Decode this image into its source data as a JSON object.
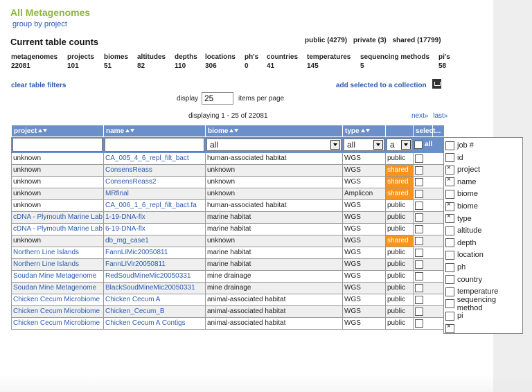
{
  "page": {
    "title": "All Metagenomes",
    "group_by": "group by project"
  },
  "counts": {
    "title": "Current table counts",
    "public": "public (4279)",
    "private": "private (3)",
    "shared": "shared (17799)",
    "cols": [
      {
        "label": "metagenomes",
        "value": "22081"
      },
      {
        "label": "projects",
        "value": "101"
      },
      {
        "label": "biomes",
        "value": "51"
      },
      {
        "label": "altitudes",
        "value": "82"
      },
      {
        "label": "depths",
        "value": "110"
      },
      {
        "label": "locations",
        "value": "306"
      },
      {
        "label": "ph's",
        "value": "0"
      },
      {
        "label": "countries",
        "value": "41"
      },
      {
        "label": "temperatures",
        "value": "145"
      },
      {
        "label": "sequencing methods",
        "value": "5"
      },
      {
        "label": "pi's",
        "value": "58"
      }
    ]
  },
  "toolbar": {
    "clear_filters": "clear table filters",
    "add_selected": "add selected to a collection",
    "display_label": "display",
    "display_value": "25",
    "per_page": "items per page",
    "displaying": "displaying 1 - 25 of 22081",
    "next": "next»",
    "last": "last»"
  },
  "table": {
    "headers": {
      "project": "project",
      "name": "name",
      "biome": "biome",
      "type": "type",
      "select": "select",
      "more": "..."
    },
    "filters": {
      "biome": "all",
      "type": "all",
      "sharing": "a",
      "select_all": "all"
    },
    "rows": [
      {
        "project": "unknown",
        "name": "CA_005_4_6_repl_filt_bact",
        "biome": "human-associated habitat",
        "type": "WGS",
        "sharing": "public"
      },
      {
        "project": "unknown",
        "name": "ConsensReass",
        "biome": "unknown",
        "type": "WGS",
        "sharing": "shared"
      },
      {
        "project": "unknown",
        "name": "ConsensReass2",
        "biome": "unknown",
        "type": "WGS",
        "sharing": "shared"
      },
      {
        "project": "unknown",
        "name": "MRfinal",
        "biome": "unknown",
        "type": "Amplicon",
        "sharing": "shared"
      },
      {
        "project": "unknown",
        "name": "CA_006_1_6_repl_filt_bact.fa",
        "biome": "human-associated habitat",
        "type": "WGS",
        "sharing": "public"
      },
      {
        "project": "cDNA - Plymouth Marine Lab Coastal Waters project",
        "name": "1-19-DNA-flx",
        "biome": "marine habitat",
        "type": "WGS",
        "sharing": "public"
      },
      {
        "project": "cDNA - Plymouth Marine Lab Coastal Waters project",
        "name": "6-19-DNA-flx",
        "biome": "marine habitat",
        "type": "WGS",
        "sharing": "public"
      },
      {
        "project": "unknown",
        "name": "db_mg_case1",
        "biome": "unknown",
        "type": "WGS",
        "sharing": "shared"
      },
      {
        "project": "Northern Line Islands",
        "name": "FannLIMic20050811",
        "biome": "marine habitat",
        "type": "WGS",
        "sharing": "public"
      },
      {
        "project": "Northern Line Islands",
        "name": "FannLIVir20050811",
        "biome": "marine habitat",
        "type": "WGS",
        "sharing": "public"
      },
      {
        "project": "Soudan Mine Metagenome",
        "name": "RedSoudMineMic20050331",
        "biome": "mine drainage",
        "type": "WGS",
        "sharing": "public"
      },
      {
        "project": "Soudan Mine Metagenome",
        "name": "BlackSoudMineMic20050331",
        "biome": "mine drainage",
        "type": "WGS",
        "sharing": "public"
      },
      {
        "project": "Chicken Cecum Microbiome",
        "name": "Chicken Cecum A",
        "biome": "animal-associated habitat",
        "type": "WGS",
        "sharing": "public"
      },
      {
        "project": "Chicken Cecum Microbiome",
        "name": "Chicken_Cecum_B",
        "biome": "animal-associated habitat",
        "type": "WGS",
        "sharing": "public"
      },
      {
        "project": "Chicken Cecum Microbiome",
        "name": "Chicken Cecum A Contigs",
        "biome": "animal-associated habitat",
        "type": "WGS",
        "sharing": "public"
      }
    ]
  },
  "column_panel": [
    {
      "label": "job #",
      "checked": false
    },
    {
      "label": "id",
      "checked": false
    },
    {
      "label": "project",
      "checked": true
    },
    {
      "label": "name",
      "checked": true
    },
    {
      "label": "biome",
      "checked": false
    },
    {
      "label": "biome",
      "checked": true
    },
    {
      "label": "type",
      "checked": true
    },
    {
      "label": "altitude",
      "checked": false
    },
    {
      "label": "depth",
      "checked": false
    },
    {
      "label": "location",
      "checked": false
    },
    {
      "label": "ph",
      "checked": false
    },
    {
      "label": "country",
      "checked": false
    },
    {
      "label": "temperature",
      "checked": false
    },
    {
      "label": "sequencing method",
      "checked": false
    },
    {
      "label": "pi",
      "checked": false
    },
    {
      "label": "",
      "checked": true
    }
  ]
}
